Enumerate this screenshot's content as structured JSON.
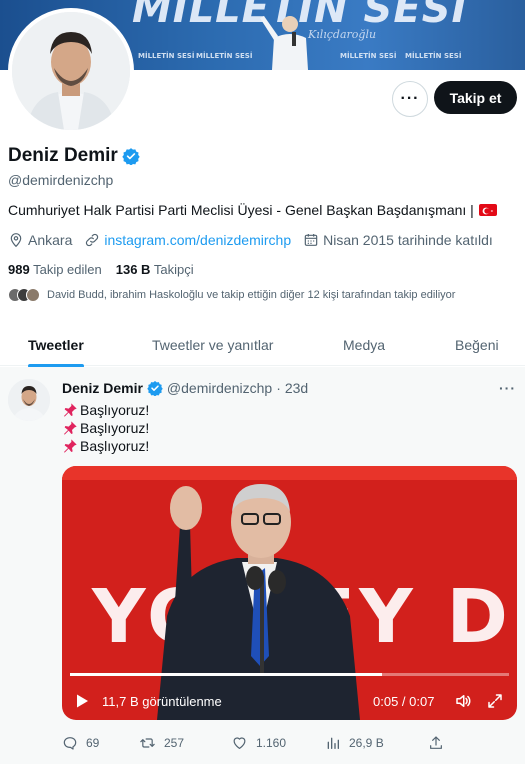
{
  "banner": {
    "title": "MILLETIN SESI",
    "signature": "Kılıçdaroğlu",
    "mini_label": "MİLLETİN SESİ"
  },
  "profile": {
    "more_label": "···",
    "follow_label": "Takip et",
    "name": "Deniz Demir",
    "handle": "@demirdenizchp",
    "bio": "Cumhuriyet Halk Partisi Parti Meclisi Üyesi - Genel Başkan Başdanışmanı |",
    "location": "Ankara",
    "link": "instagram.com/denizdemirchp",
    "joined": "Nisan 2015 tarihinde katıldı",
    "following_count": "989",
    "following_label": "Takip edilen",
    "followers_count": "136 B",
    "followers_label": "Takipçi",
    "followed_by": "David Budd, ibrahim Haskoloğlu ve takip ettiğin diğer 12 kişi tarafından takip ediliyor"
  },
  "tabs": [
    "Tweetler",
    "Tweetler ve yanıtlar",
    "Medya",
    "Beğeni"
  ],
  "tweet": {
    "name": "Deniz Demir",
    "handle": "@demirdenizchp",
    "separator": "·",
    "time": "23d",
    "lines": [
      "Başlıyoruz!",
      "Başlıyoruz!",
      "Başlıyoruz!"
    ],
    "video": {
      "background_text": "YOR  EY D",
      "views": "11,7 B görüntülenme",
      "time": "0:05 / 0:07",
      "progress": 0.71
    },
    "actions": {
      "replies": "69",
      "retweets": "257",
      "likes": "1.160",
      "views": "26,9 B"
    }
  },
  "colors": {
    "accent": "#1d9bf0",
    "verified": "#1d9bf0",
    "follow_bg": "#0f1419",
    "video_red": "#d2201c"
  }
}
